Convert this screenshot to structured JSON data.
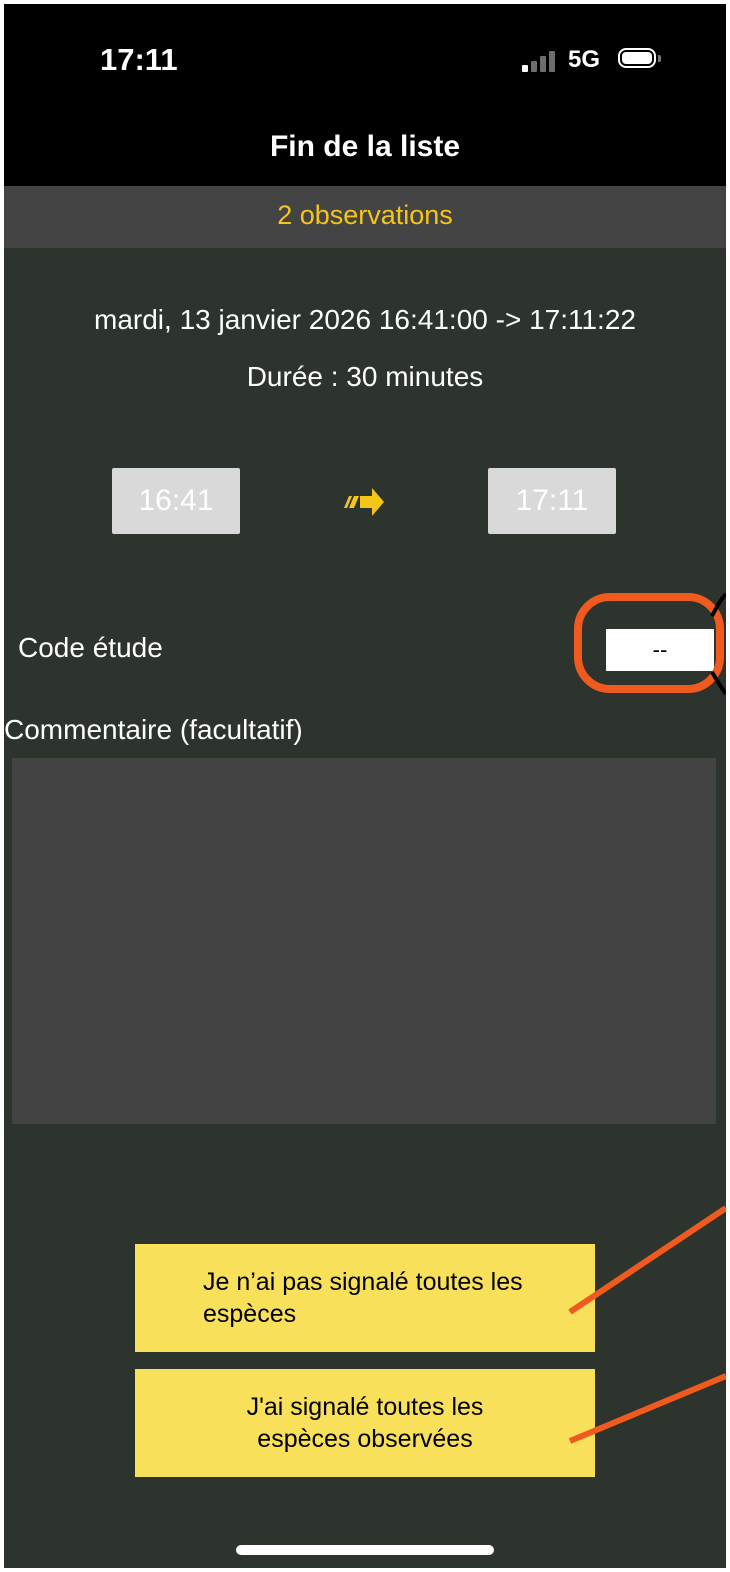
{
  "status_bar": {
    "time": "17:11",
    "network": "5G"
  },
  "nav": {
    "title": "Fin de la liste"
  },
  "observations": {
    "count_label": "2 observations"
  },
  "session": {
    "range": "mardi, 13 janvier 2026 16:41:00 -> 17:11:22",
    "duration": "Durée : 30 minutes",
    "start_time": "16:41",
    "end_time": "17:11"
  },
  "form": {
    "code_label": "Code étude",
    "code_value": "--",
    "comment_label": "Commentaire (facultatif)",
    "comment_value": ""
  },
  "buttons": {
    "not_all_species": "Je n’ai pas signalé toutes les espèces",
    "all_species": "J'ai signalé toutes les espèces observées"
  },
  "colors": {
    "background": "#2d332d",
    "accent_yellow": "#f5c518",
    "button_yellow": "#f9e05a",
    "annotation_orange": "#f05a1e"
  },
  "icons": {
    "arrow": "double-arrow-right-icon"
  }
}
